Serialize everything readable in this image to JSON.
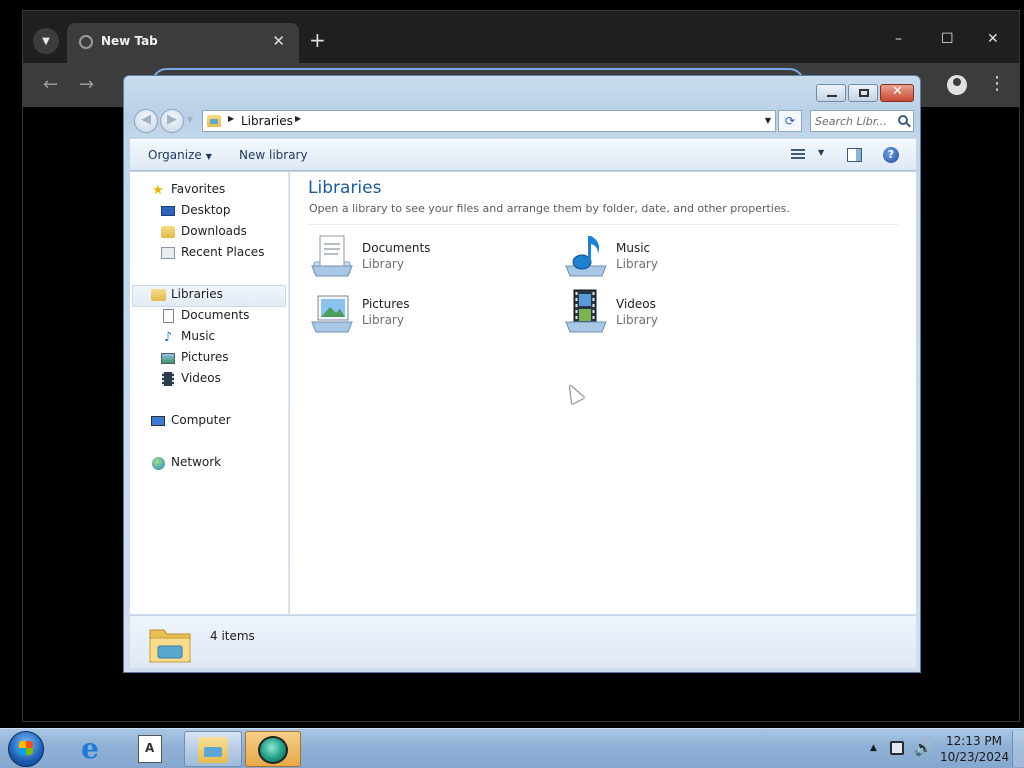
{
  "browser": {
    "tab_title": "New Tab",
    "tab_close": "✕",
    "new_tab": "+",
    "window_controls": {
      "minimize": "–",
      "maximize": "☐",
      "close": "✕"
    }
  },
  "explorer": {
    "breadcrumb": "Libraries",
    "search_placeholder": "Search Libr...",
    "toolbar": {
      "organize_label": "Organize",
      "new_library_label": "New library"
    },
    "nav": {
      "favorites": "Favorites",
      "desktop": "Desktop",
      "downloads": "Downloads",
      "recent_places": "Recent Places",
      "libraries": "Libraries",
      "documents": "Documents",
      "music": "Music",
      "pictures": "Pictures",
      "videos": "Videos",
      "computer": "Computer",
      "network": "Network"
    },
    "content": {
      "heading": "Libraries",
      "description": "Open a library to see your files and arrange them by folder, date, and other properties.",
      "libraries": [
        {
          "name": "Documents",
          "kind": "Library"
        },
        {
          "name": "Music",
          "kind": "Library"
        },
        {
          "name": "Pictures",
          "kind": "Library"
        },
        {
          "name": "Videos",
          "kind": "Library"
        }
      ]
    },
    "status": {
      "item_count": "4 items"
    }
  },
  "taskbar": {
    "clock_time": "12:13 PM",
    "clock_date": "10/23/2024"
  },
  "colors": {
    "heading_blue": "#1e5a96",
    "taskbar_blue": "#8fb0d6",
    "selected_nav": "#e2ebf6"
  }
}
